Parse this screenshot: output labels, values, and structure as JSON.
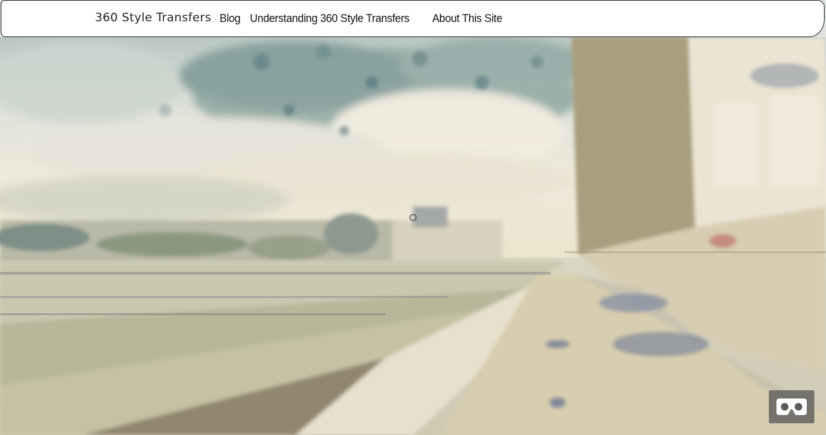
{
  "navbar": {
    "brand": "360 Style Transfers",
    "links": [
      "Blog",
      "Understanding 360 Style Transfers",
      "About This Site"
    ]
  },
  "viewer": {
    "vr_button_icon": "vr-headset-icon",
    "cursor_icon": "circle-cursor-icon"
  },
  "colors": {
    "nav_bg": "#ffffff",
    "nav_border": "#2a2a2a",
    "vr_button_bg": "#5a5a5a"
  }
}
